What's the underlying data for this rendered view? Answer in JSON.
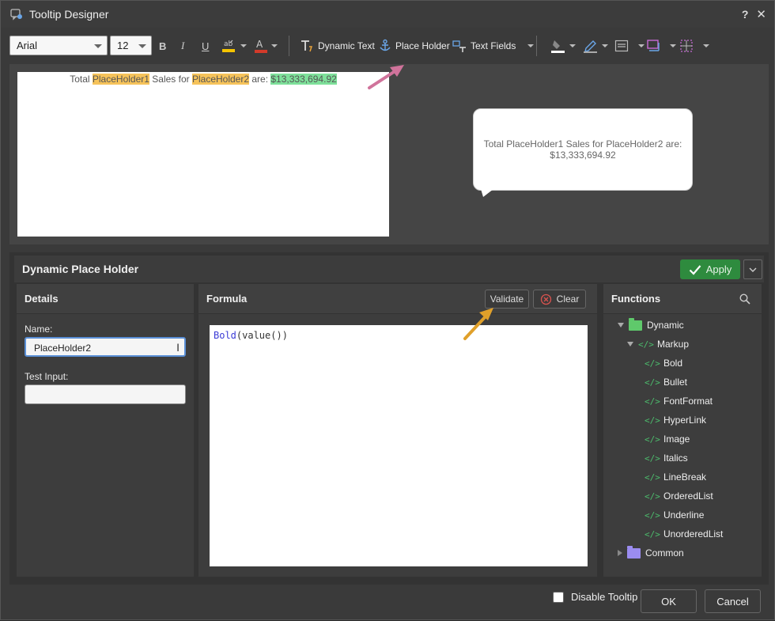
{
  "window": {
    "title": "Tooltip Designer",
    "help_glyph": "?",
    "close_glyph": "✕"
  },
  "toolbar": {
    "font": "Arial",
    "size": "12",
    "bold": "B",
    "italic": "I",
    "underline": "U",
    "dynamic_text": "Dynamic Text",
    "place_holder": "Place Holder",
    "text_fields": "Text Fields"
  },
  "preview": {
    "p1": "Total ",
    "placeholder1": "PlaceHolder1",
    "p2": " Sales for ",
    "placeholder2": "PlaceHolder2",
    "p3": " are: ",
    "amount": "$13,333,694.92",
    "tooltip_text": "Total PlaceHolder1 Sales for PlaceHolder2 are: $13,333,694.92"
  },
  "panel": {
    "title": "Dynamic Place Holder",
    "apply_label": "Apply"
  },
  "details": {
    "title": "Details",
    "name_label": "Name:",
    "name_value": "PlaceHolder2",
    "test_input_label": "Test Input:",
    "test_input_value": ""
  },
  "formula": {
    "title": "Formula",
    "validate_label": "Validate",
    "clear_label": "Clear",
    "code_fn": "Bold",
    "code_rest": "(value())"
  },
  "functions": {
    "title": "Functions",
    "root": "Dynamic",
    "group": "Markup",
    "items": [
      "Bold",
      "Bullet",
      "FontFormat",
      "HyperLink",
      "Image",
      "Italics",
      "LineBreak",
      "OrderedList",
      "Underline",
      "UnorderedList"
    ],
    "other": "Common",
    "code_glyph": "</>"
  },
  "footer": {
    "disable_tooltip": "Disable Tooltip",
    "ok": "OK",
    "cancel": "Cancel"
  },
  "colors": {
    "apply_green": "#2e8b3e",
    "highlight_orange": "#f6c35a",
    "highlight_green": "#7ee09a",
    "folder_green": "#5fc96b",
    "folder_purple": "#9b8cf0",
    "arrow_pink": "#d0739b",
    "arrow_gold": "#e0a02a"
  }
}
